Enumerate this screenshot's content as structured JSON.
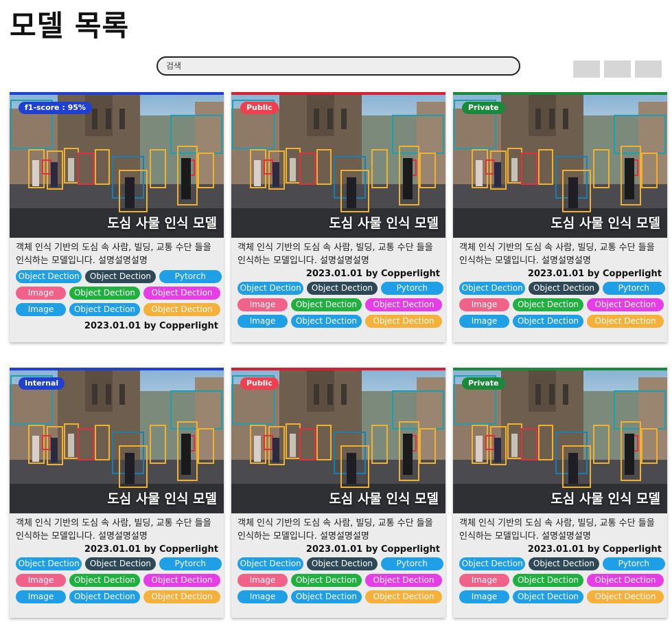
{
  "page": {
    "title": "모델 목록"
  },
  "search": {
    "placeholder": "검색"
  },
  "colors": {
    "blue": "#1f40d0",
    "red": "#d42030",
    "green": "#1a8a3a",
    "tag_sky": "#1e9fe6",
    "tag_dark": "#2f4858",
    "tag_pink": "#f0628a",
    "tag_green": "#20b040",
    "tag_magenta": "#e63ee6",
    "tag_orange": "#f5b13a"
  },
  "cards": [
    {
      "accent": "#1f40d0",
      "badge_color": "#1f40d0",
      "badge": "f1-score : 95%",
      "thumbnail_caption": "도심 사물 인식 모델",
      "description": "객체 인식 기반의 도심 속 사람, 빌딩, 교통 수단 들을 인식하는 모델입니다. 설명설명설명",
      "date_author": "2023.01.01 by Copperlight",
      "date_position": "bottom",
      "tags": [
        [
          {
            "label": "Object Dection",
            "color": "#1e9fe6"
          },
          {
            "label": "Object Dection",
            "color": "#2f4858"
          },
          {
            "label": "Pytorch",
            "color": "#1e9fe6"
          }
        ],
        [
          {
            "label": "Image",
            "color": "#f0628a"
          },
          {
            "label": "Object Dection",
            "color": "#20b040"
          },
          {
            "label": "Object Dection",
            "color": "#e63ee6"
          }
        ],
        [
          {
            "label": "Image",
            "color": "#1e9fe6"
          },
          {
            "label": "Object Dection",
            "color": "#1e9fe6"
          },
          {
            "label": "Object Dection",
            "color": "#f5b13a"
          }
        ]
      ]
    },
    {
      "accent": "#d42030",
      "badge_color": "#f04050",
      "badge": "Public",
      "thumbnail_caption": "도심 사물 인식 모델",
      "description": "객체 인식 기반의 도심 속 사람, 빌딩, 교통 수단 들을 인식하는 모델입니다. 설명설명설명",
      "date_author": "2023.01.01 by Copperlight",
      "date_position": "top",
      "tags": [
        [
          {
            "label": "Object Dection",
            "color": "#1e9fe6"
          },
          {
            "label": "Object Dection",
            "color": "#2f4858"
          },
          {
            "label": "Pytorch",
            "color": "#1e9fe6"
          }
        ],
        [
          {
            "label": "Image",
            "color": "#f0628a"
          },
          {
            "label": "Object Dection",
            "color": "#20b040"
          },
          {
            "label": "Object Dection",
            "color": "#e63ee6"
          }
        ],
        [
          {
            "label": "Image",
            "color": "#1e9fe6"
          },
          {
            "label": "Object Dection",
            "color": "#1e9fe6"
          },
          {
            "label": "Object Dection",
            "color": "#f5b13a"
          }
        ]
      ]
    },
    {
      "accent": "#1a8a3a",
      "badge_color": "#1a8a3a",
      "badge": "Private",
      "thumbnail_caption": "도심 사물 인식 모델",
      "description": "객체 인식 기반의 도심 속 사람, 빌딩, 교통 수단 들을 인식하는 모델입니다. 설명설명설명",
      "date_author": "2023.01.01 by Copperlight",
      "date_position": "top",
      "tags": [
        [
          {
            "label": "Object Dection",
            "color": "#1e9fe6"
          },
          {
            "label": "Object Dection",
            "color": "#2f4858"
          },
          {
            "label": "Pytorch",
            "color": "#1e9fe6"
          }
        ],
        [
          {
            "label": "Image",
            "color": "#f0628a"
          },
          {
            "label": "Object Dection",
            "color": "#20b040"
          },
          {
            "label": "Object Dection",
            "color": "#e63ee6"
          }
        ],
        [
          {
            "label": "Image",
            "color": "#1e9fe6"
          },
          {
            "label": "Object Dection",
            "color": "#1e9fe6"
          },
          {
            "label": "Object Dection",
            "color": "#f5b13a"
          }
        ]
      ]
    },
    {
      "accent": "#1f40d0",
      "badge_color": "#1f40d0",
      "badge": "Internal",
      "thumbnail_caption": "도심 사물 인식 모델",
      "description": "객체 인식 기반의 도심 속 사람, 빌딩, 교통 수단 들을 인식하는 모델입니다. 설명설명설명",
      "date_author": "2023.01.01 by Copperlight",
      "date_position": "top",
      "tags": [
        [
          {
            "label": "Object Dection",
            "color": "#1e9fe6"
          },
          {
            "label": "Object Dection",
            "color": "#2f4858"
          },
          {
            "label": "Pytorch",
            "color": "#1e9fe6"
          }
        ],
        [
          {
            "label": "Image",
            "color": "#f0628a"
          },
          {
            "label": "Object Dection",
            "color": "#20b040"
          },
          {
            "label": "Object Dection",
            "color": "#e63ee6"
          }
        ],
        [
          {
            "label": "Image",
            "color": "#1e9fe6"
          },
          {
            "label": "Object Dection",
            "color": "#1e9fe6"
          },
          {
            "label": "Object Dection",
            "color": "#f5b13a"
          }
        ]
      ]
    },
    {
      "accent": "#d42030",
      "badge_color": "#f04050",
      "badge": "Public",
      "thumbnail_caption": "도심 사물 인식 모델",
      "description": "객체 인식 기반의 도심 속 사람, 빌딩, 교통 수단 들을 인식하는 모델입니다. 설명설명설명",
      "date_author": "2023.01.01 by Copperlight",
      "date_position": "top",
      "tags": [
        [
          {
            "label": "Object Dection",
            "color": "#1e9fe6"
          },
          {
            "label": "Object Dection",
            "color": "#2f4858"
          },
          {
            "label": "Pytorch",
            "color": "#1e9fe6"
          }
        ],
        [
          {
            "label": "Image",
            "color": "#f0628a"
          },
          {
            "label": "Object Dection",
            "color": "#20b040"
          },
          {
            "label": "Object Dection",
            "color": "#e63ee6"
          }
        ],
        [
          {
            "label": "Image",
            "color": "#1e9fe6"
          },
          {
            "label": "Object Dection",
            "color": "#1e9fe6"
          },
          {
            "label": "Object Dection",
            "color": "#f5b13a"
          }
        ]
      ]
    },
    {
      "accent": "#1a8a3a",
      "badge_color": "#1a8a3a",
      "badge": "Private",
      "thumbnail_caption": "도심 사물 인식 모델",
      "description": "객체 인식 기반의 도심 속 사람, 빌딩, 교통 수단 들을 인식하는 모델입니다. 설명설명설명",
      "date_author": "2023.01.01 by Copperlight",
      "date_position": "top",
      "tags": [
        [
          {
            "label": "Object Dection",
            "color": "#1e9fe6"
          },
          {
            "label": "Object Dection",
            "color": "#2f4858"
          },
          {
            "label": "Pytorch",
            "color": "#1e9fe6"
          }
        ],
        [
          {
            "label": "Image",
            "color": "#f0628a"
          },
          {
            "label": "Object Dection",
            "color": "#20b040"
          },
          {
            "label": "Object Dection",
            "color": "#e63ee6"
          }
        ],
        [
          {
            "label": "Image",
            "color": "#1e9fe6"
          },
          {
            "label": "Object Dection",
            "color": "#1e9fe6"
          },
          {
            "label": "Object Dection",
            "color": "#f5b13a"
          }
        ]
      ]
    }
  ]
}
